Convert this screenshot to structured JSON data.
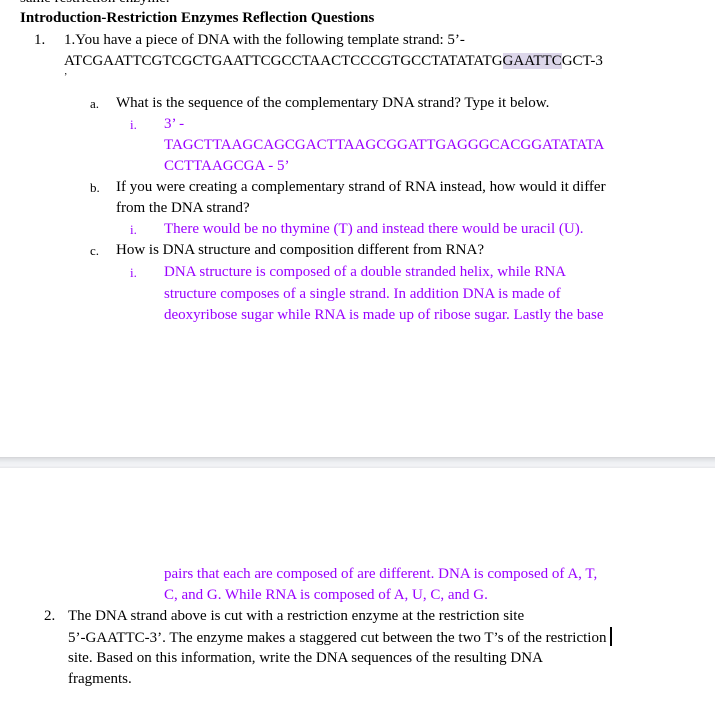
{
  "document": {
    "cutoff_text": "same restriction enzyme.",
    "heading": "Introduction-Restriction Enzymes Reflection Questions",
    "colors": {
      "answer_text": "#9900ff",
      "highlight": "#dcd6ea",
      "body_text": "#000000"
    },
    "q1": {
      "marker": "1.",
      "line1": "1.You have a piece of DNA with the following template strand: 5’-",
      "seq_before_highlight": "ATCGAATTCGTCGCTGAATTCGCCTAACTCCCGTGCCTATATATG",
      "seq_highlight": "GAATTC",
      "seq_after_highlight": "GCT-3",
      "trailing_mark": "’",
      "a": {
        "marker": "a.",
        "question": "What is the sequence of the complementary DNA strand? Type it below.",
        "answer_marker": "i.",
        "answer_lines": [
          "3’ -",
          "TAGCTTAAGCAGCGACTTAAGCGGATTGAGGGCACGGATATATA",
          "CCTTAAGCGA - 5’"
        ]
      },
      "b": {
        "marker": "b.",
        "question_lines": [
          "If you were creating a complementary strand of RNA instead, how would it differ",
          "from the DNA strand?"
        ],
        "answer_marker": "i.",
        "answer": "There would be no thymine (T) and instead there would be uracil (U)."
      },
      "c": {
        "marker": "c.",
        "question": "How is DNA structure and composition different from RNA?",
        "answer_marker": "i.",
        "answer_lines_page1": [
          "DNA structure is composed of a double stranded helix, while RNA",
          "structure composes of a single strand. In addition DNA is made of",
          "deoxyribose sugar while RNA is made up of ribose sugar. Lastly the base"
        ],
        "answer_lines_page2": [
          "pairs that each are composed of are different. DNA is composed of A, T,",
          "C, and G. While RNA is composed of A, U, C, and G."
        ]
      }
    },
    "q2": {
      "marker": "2.",
      "lines": [
        "The DNA strand above is cut with a restriction enzyme at the restriction site",
        "5’-GAATTC-3’. The enzyme makes a staggered cut between the two T’s of the restriction",
        "site. Based on this information, write the DNA sequences of the resulting DNA",
        "fragments."
      ]
    }
  }
}
